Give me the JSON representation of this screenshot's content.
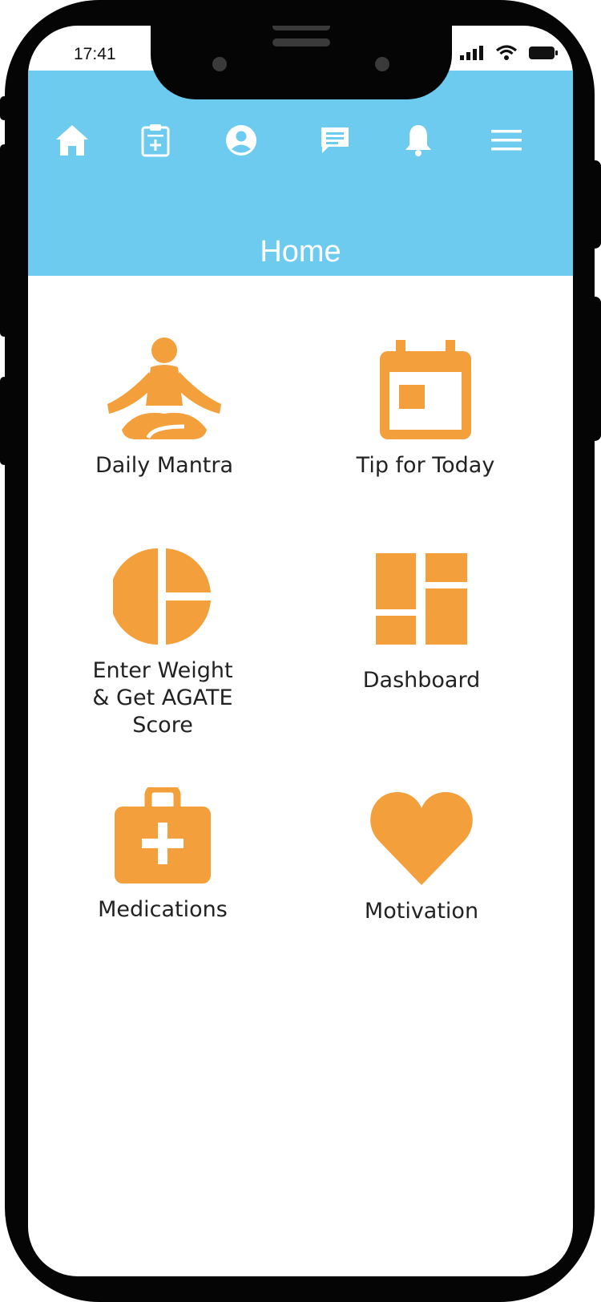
{
  "status_bar": {
    "time": "17:41"
  },
  "nav": {
    "items": [
      {
        "icon": "home-icon"
      },
      {
        "icon": "clipboard-icon"
      },
      {
        "icon": "account-icon"
      },
      {
        "icon": "chat-icon"
      },
      {
        "icon": "bell-icon"
      },
      {
        "icon": "menu-icon"
      }
    ]
  },
  "page": {
    "title": "Home"
  },
  "tiles": [
    {
      "label": "Daily Mantra",
      "icon": "meditation-icon"
    },
    {
      "label": "Tip for Today",
      "icon": "calendar-icon"
    },
    {
      "label": "Enter Weight & Get AGATE Score",
      "icon": "pie-chart-icon"
    },
    {
      "label": "Dashboard",
      "icon": "dashboard-icon"
    },
    {
      "label": "Medications",
      "icon": "first-aid-kit-icon"
    },
    {
      "label": "Motivation",
      "icon": "heart-icon"
    }
  ],
  "colors": {
    "header": "#6ccbee",
    "accent": "#f29f3c",
    "frame": "#050505"
  }
}
